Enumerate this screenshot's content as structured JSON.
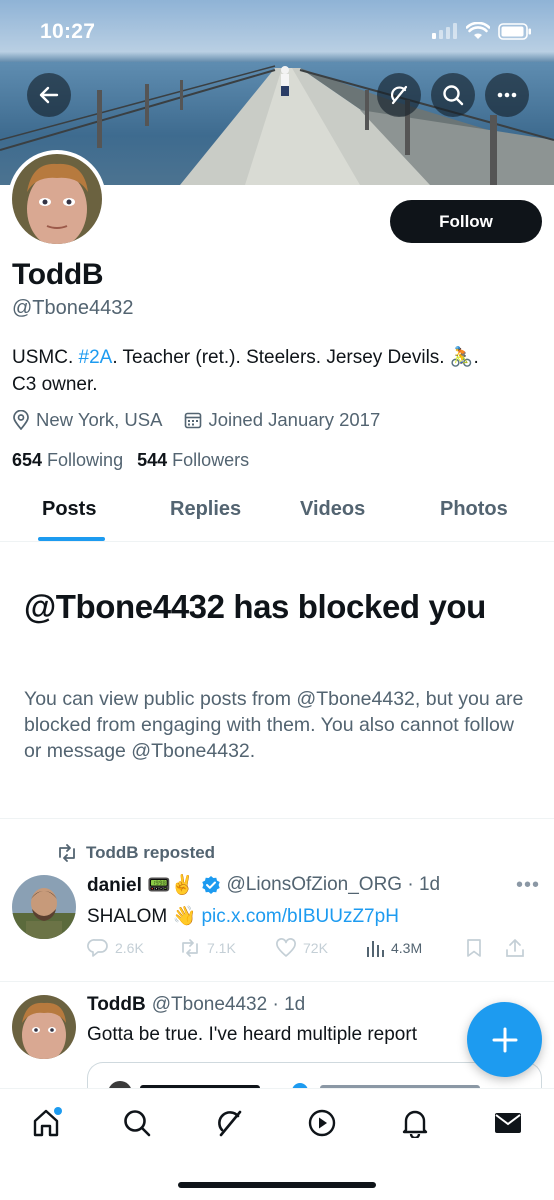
{
  "status_bar": {
    "time": "10:27"
  },
  "profile": {
    "name": "ToddB",
    "handle": "@Tbone4432",
    "bio_prefix": "USMC. ",
    "bio_tag": "#2A",
    "bio_rest_line1": ". Teacher (ret.). Steelers. Jersey Devils. 🚴.",
    "bio_line2": "C3 owner.",
    "location": "New York, USA",
    "joined": "Joined January 2017",
    "following_count": "654",
    "following_label": "Following",
    "followers_count": "544",
    "followers_label": "Followers",
    "follow_button": "Follow"
  },
  "tabs": [
    {
      "label": "Posts",
      "active": true
    },
    {
      "label": "Replies",
      "active": false
    },
    {
      "label": "Videos",
      "active": false
    },
    {
      "label": "Photos",
      "active": false
    }
  ],
  "blocked": {
    "title": "@Tbone4432 has blocked you",
    "text": "You can view public posts from @Tbone4432, but you are blocked from engaging with them. You also cannot follow or message @Tbone4432."
  },
  "posts": [
    {
      "repost_label": "ToddB reposted",
      "author": "daniel 📟✌️",
      "handle_time": "@LionsOfZion_ORG · 1d",
      "text": "SHALOM 👋 ",
      "link": "pic.x.com/bIBUUzZ7pH",
      "replies": "2.6K",
      "reposts": "7.1K",
      "likes": "72K",
      "views": "4.3M"
    },
    {
      "author": "ToddB",
      "handle_time": "@Tbone4432 · 1d",
      "text": "Gotta be true.  I've heard multiple report"
    }
  ],
  "colors": {
    "accent": "#1d9bf0",
    "text": "#0f1419",
    "muted": "#536471"
  }
}
